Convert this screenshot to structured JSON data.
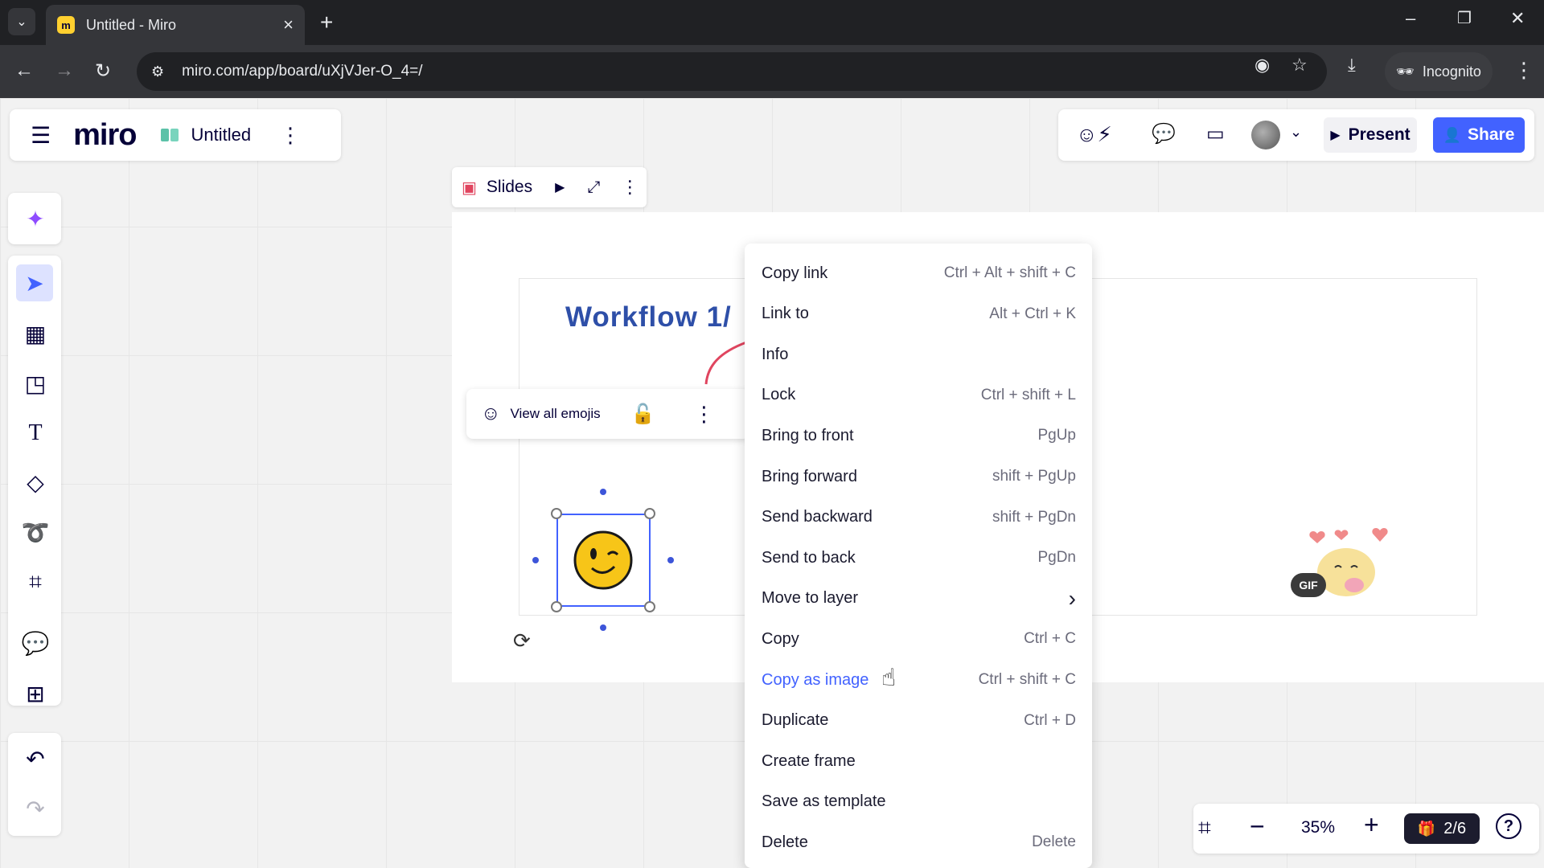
{
  "browser": {
    "tab_title": "Untitled - Miro",
    "url": "miro.com/app/board/uXjVJer-O_4=/",
    "incognito_label": "Incognito"
  },
  "board": {
    "logo": "miro",
    "title": "Untitled",
    "present_label": "Present",
    "share_label": "Share",
    "accent_color": "#4262ff"
  },
  "slides": {
    "label": "Slides"
  },
  "canvas": {
    "workflow_title": "Workflow 1/",
    "view_emojis_label": "View all emojis",
    "gif_badge": "GIF"
  },
  "context_menu": {
    "items": [
      {
        "label": "Copy link",
        "shortcut": "Ctrl + Alt + shift + C"
      },
      {
        "label": "Link to",
        "shortcut": "Alt + Ctrl + K"
      },
      {
        "label": "Info",
        "shortcut": ""
      },
      {
        "label": "Lock",
        "shortcut": "Ctrl + shift + L"
      },
      {
        "label": "Bring to front",
        "shortcut": "PgUp"
      },
      {
        "label": "Bring forward",
        "shortcut": "shift + PgUp"
      },
      {
        "label": "Send backward",
        "shortcut": "shift + PgDn"
      },
      {
        "label": "Send to back",
        "shortcut": "PgDn"
      },
      {
        "label": "Move to layer",
        "shortcut": "›"
      },
      {
        "label": "Copy",
        "shortcut": "Ctrl + C"
      },
      {
        "label": "Copy as image",
        "shortcut": "Ctrl + shift + C"
      },
      {
        "label": "Duplicate",
        "shortcut": "Ctrl + D"
      },
      {
        "label": "Create frame",
        "shortcut": ""
      },
      {
        "label": "Save as template",
        "shortcut": ""
      },
      {
        "label": "Delete",
        "shortcut": "Delete"
      }
    ],
    "hovered_item": "Copy as image"
  },
  "footer": {
    "zoom": "35%",
    "page_indicator": "2/6"
  }
}
